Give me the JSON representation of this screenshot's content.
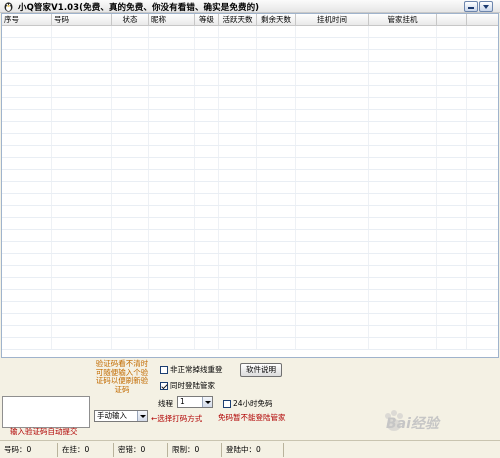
{
  "window": {
    "title": "小Q管家V1.03(免费、真的免费、你没有看错、确实是免费的)",
    "min_icon": "minimize-icon",
    "menu_icon": "menu-arrow-icon",
    "app_icon": "penguin-icon"
  },
  "table": {
    "columns": [
      "序号",
      "号码",
      "状态",
      "昵称",
      "等级",
      "活跃天数",
      "剩余天数",
      "挂机时间",
      "管家挂机",
      "",
      ""
    ],
    "rows": []
  },
  "panel": {
    "hint": "验证码看不清时可随便输入个验证码以便刷新验证码",
    "submit_label": "输入验证码自动提交",
    "reconnect_label": "非正常掉线重登",
    "guard_label": "同时登陆管家",
    "help_button": "软件说明",
    "thread_label": "线程",
    "thread_value": "1",
    "free_24h_label": "24小时免码",
    "mode_value": "手动输入",
    "mode_note": "←选择打码方式",
    "free_note": "免码暂不能登陆管家"
  },
  "status": {
    "number": "号码：0",
    "online": "在挂：0",
    "wrong_pwd": "密错：0",
    "limited": "限制：0",
    "logging_in": "登陆中：0"
  },
  "watermark": "Bai经验"
}
